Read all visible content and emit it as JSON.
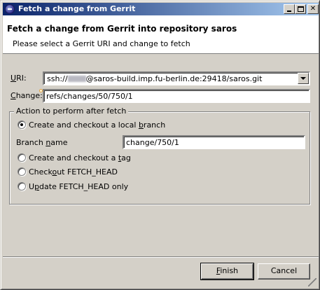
{
  "window": {
    "title": "Fetch a change from Gerrit",
    "minimize_glyph": "_",
    "maximize_glyph": "□",
    "close_glyph": "✕",
    "icon": "eclipse-icon"
  },
  "header": {
    "title": "Fetch a change from Gerrit into repository saros",
    "description": "Please select a Gerrit URI and change to fetch"
  },
  "form": {
    "uri_label_u": "U",
    "uri_label_rest": "RI:",
    "uri_prefix": "ssh://",
    "uri_suffix": "@saros-build.imp.fu-berlin.de:29418/saros.git",
    "change_label_u": "C",
    "change_label_rest": "hange:",
    "change_value": "refs/changes/50/750/1"
  },
  "group": {
    "title": "Action to perform after fetch",
    "option1_pre": "Create and checkout a local ",
    "option1_u": "b",
    "option1_post": "ranch",
    "branch_label_pre": "Branch ",
    "branch_label_u": "n",
    "branch_label_post": "ame",
    "branch_value": "change/750/1",
    "option2_pre": "Create and checkout a ",
    "option2_u": "t",
    "option2_post": "ag",
    "option3_pre": "Check",
    "option3_u": "o",
    "option3_post": "ut FETCH_HEAD",
    "option4_pre": "U",
    "option4_u": "p",
    "option4_post": "date FETCH_HEAD only",
    "selected_option": 1
  },
  "buttons": {
    "finish_u": "F",
    "finish_rest": "inish",
    "cancel": "Cancel"
  }
}
